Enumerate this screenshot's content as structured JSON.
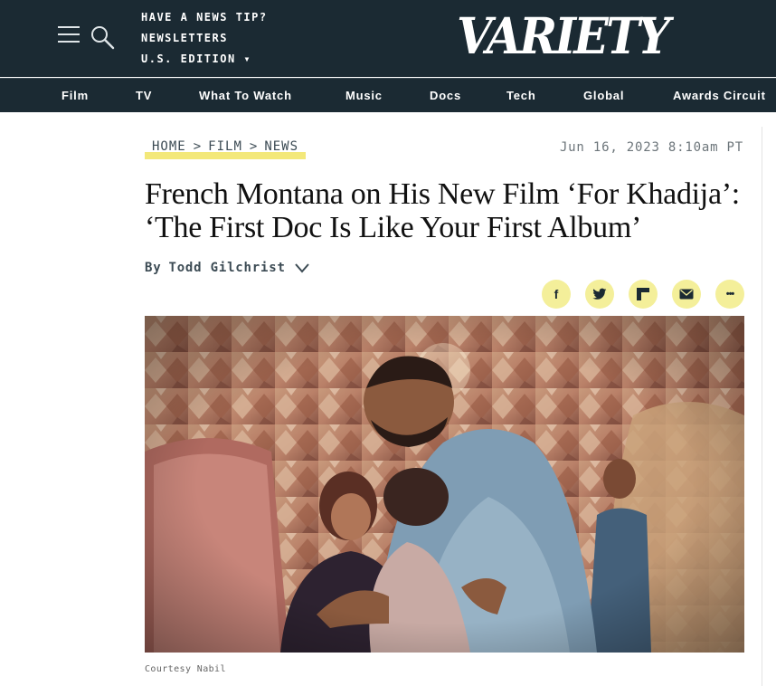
{
  "header": {
    "top_links": [
      "HAVE A NEWS TIP?",
      "NEWSLETTERS",
      "U.S. EDITION ▾"
    ],
    "logo_text": "VARIETY",
    "nav": [
      "Film",
      "TV",
      "What To Watch",
      "Music",
      "Docs",
      "Tech",
      "Global",
      "Awards Circuit"
    ]
  },
  "article": {
    "breadcrumb": [
      "HOME",
      "FILM",
      "NEWS"
    ],
    "breadcrumb_separator": ">",
    "timestamp": "Jun 16, 2023 8:10am PT",
    "headline": "French Montana on His New Film ‘For Khadija’: ‘The First Doc Is Like Your First Album’",
    "byline_prefix": "By",
    "author": "Todd Gilchrist",
    "share": [
      {
        "icon": "facebook-icon",
        "glyph": "f"
      },
      {
        "icon": "twitter-icon",
        "glyph": "🐦"
      },
      {
        "icon": "flipboard-icon",
        "glyph": "F"
      },
      {
        "icon": "email-icon",
        "glyph": "✉"
      },
      {
        "icon": "more-icon",
        "glyph": "•••"
      }
    ],
    "image_caption": "Courtesy Nabil"
  },
  "colors": {
    "header_bg": "#1b2a33",
    "highlight": "#f3e87a",
    "share_bg": "#f4ef9a"
  }
}
